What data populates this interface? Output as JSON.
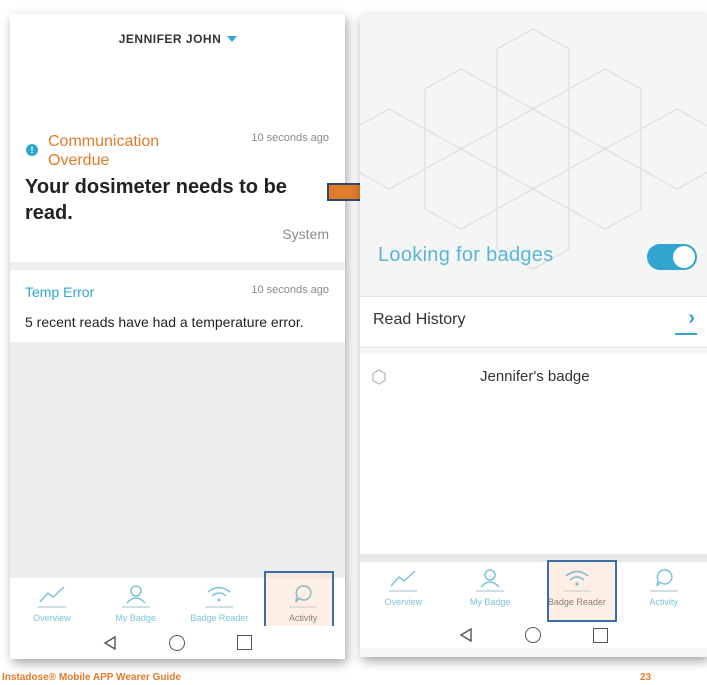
{
  "left_screen": {
    "user_name": "JENNIFER JOHN",
    "notifications": [
      {
        "title": "Communication Overdue",
        "time": "10 seconds ago",
        "message": "Your dosimeter needs to be read.",
        "source": "System"
      },
      {
        "title": "Temp Error",
        "time": "10 seconds ago",
        "message": "5 recent reads have had a temperature error."
      }
    ],
    "nav": [
      {
        "label": "Overview",
        "icon": "trend-icon"
      },
      {
        "label": "My Badge",
        "icon": "person-icon"
      },
      {
        "label": "Badge Reader",
        "icon": "wifi-icon"
      },
      {
        "label": "Activity",
        "icon": "chat-icon",
        "active": true
      }
    ]
  },
  "right_screen": {
    "looking_label": "Looking for badges",
    "toggle_on": true,
    "read_history_label": "Read History",
    "badges": [
      {
        "name": "Jennifer's badge"
      }
    ],
    "nav": [
      {
        "label": "Overview",
        "icon": "trend-icon"
      },
      {
        "label": "My Badge",
        "icon": "person-icon"
      },
      {
        "label": "Badge Reader",
        "icon": "wifi-icon",
        "active": true
      },
      {
        "label": "Activity",
        "icon": "chat-icon"
      }
    ]
  },
  "footer": {
    "guide_title": "Instadose® Mobile APP Wearer Guide",
    "page_number": "23"
  },
  "colors": {
    "accent": "#2fa5d0",
    "warning": "#e17a2b",
    "highlight_border": "#3a6ea8"
  }
}
